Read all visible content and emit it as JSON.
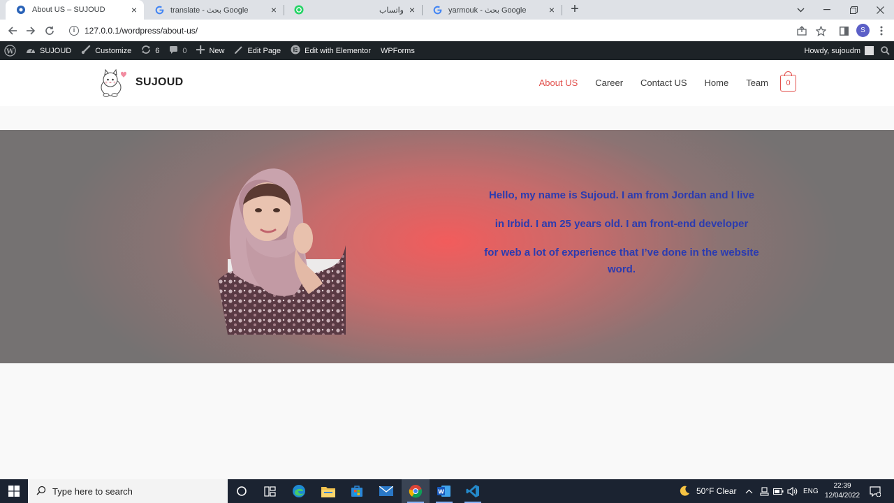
{
  "browser": {
    "tabs": [
      {
        "title": "About US – SUJOUD",
        "active": true
      },
      {
        "title": "translate - بحث Google",
        "active": false
      },
      {
        "title": "واتساب",
        "active": false
      },
      {
        "title": "yarmouk - بحث Google",
        "active": false
      }
    ],
    "url": "127.0.0.1/wordpress/about-us/",
    "profile_initial": "S"
  },
  "adminbar": {
    "site": "SUJOUD",
    "customize": "Customize",
    "updates": "6",
    "comments": "0",
    "new": "New",
    "edit_page": "Edit Page",
    "elementor": "Edit with Elementor",
    "wpforms": "WPForms",
    "howdy": "Howdy, sujoudm"
  },
  "site": {
    "name": "SUJOUD",
    "menu": [
      "About US",
      "Career",
      "Contact US",
      "Home",
      "Team"
    ],
    "cart_count": "0"
  },
  "hero": {
    "bio_line1": "Hello, my name is Sujoud. I am from Jordan and I live",
    "bio_line2": "in Irbid. I am 25 years old. I am front-end developer",
    "bio_line3": "for web a lot of experience that I’ve done in the website word."
  },
  "taskbar": {
    "search_placeholder": "Type here to search",
    "weather": "50°F  Clear",
    "language": "ENG",
    "time": "22:39",
    "date": "12/04/2022"
  },
  "colors": {
    "accent": "#e2504c",
    "bio_text": "#2b3bb0",
    "adminbar_bg": "#1d2327",
    "taskbar_bg": "#1b2331"
  }
}
